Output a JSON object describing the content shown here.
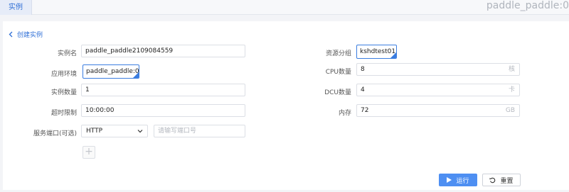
{
  "header": {
    "tab_label": "实例",
    "title": "paddle_paddle:0"
  },
  "back": {
    "label": "创建实例"
  },
  "form_left": {
    "instance_name": {
      "label": "实例名",
      "value": "paddle_paddle2109084559"
    },
    "environment": {
      "label": "应用环境",
      "value": "paddle_paddle:0"
    },
    "instance_count": {
      "label": "实例数量",
      "value": "1"
    },
    "timeout": {
      "label": "超时限制",
      "value": "10:00:00"
    },
    "service_port": {
      "label": "服务端口(可选)",
      "protocol": "HTTP",
      "port_placeholder": "请输写端口号"
    }
  },
  "form_right": {
    "resource_group": {
      "label": "资源分组",
      "value": "kshdtest01"
    },
    "cpu": {
      "label": "CPU数量",
      "value": "8",
      "unit": "核"
    },
    "dcu": {
      "label": "DCU数量",
      "value": "4",
      "unit": "卡"
    },
    "memory": {
      "label": "内存",
      "value": "72",
      "unit": "GB"
    }
  },
  "actions": {
    "run_label": "运行",
    "reset_label": "重置"
  },
  "colors": {
    "accent": "#2f6fd6",
    "primary_button": "#4e8ff2"
  }
}
